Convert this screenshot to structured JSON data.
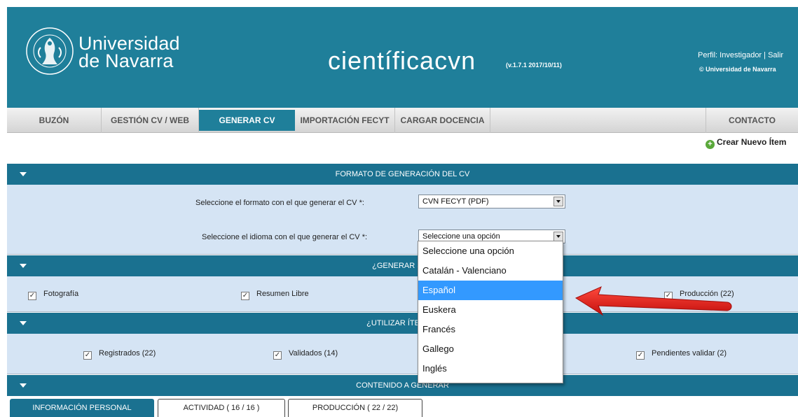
{
  "header": {
    "university_line1": "Universidad",
    "university_line2": "de Navarra",
    "app_title": "científicacvn",
    "version": "(v.1.7.1 2017/10/11)",
    "profile_text": "Perfil: Investigador | Salir",
    "copyright": "© Universidad de Navarra"
  },
  "nav": {
    "items": [
      {
        "label": "BUZÓN"
      },
      {
        "label": "GESTIÓN CV / WEB"
      },
      {
        "label": "GENERAR CV"
      },
      {
        "label": "IMPORTACIÓN FECYT"
      },
      {
        "label": "CARGAR DOCENCIA"
      }
    ],
    "contact": "CONTACTO",
    "active": "GENERAR CV"
  },
  "create_item": "Crear Nuevo Ítem",
  "sections": {
    "format": {
      "title": "FORMATO DE GENERACIÓN DEL CV",
      "format_label": "Seleccione el formato con el que generar el CV *:",
      "format_value": "CVN FECYT (PDF)",
      "language_label": "Seleccione el idioma con el que generar el CV *:",
      "language_value": "Seleccione una opción"
    },
    "generate": {
      "title": "¿GENERAR SEC",
      "items": [
        {
          "label": "Fotografía",
          "checked": true
        },
        {
          "label": "Resumen Libre",
          "checked": true
        },
        {
          "label": "Producción (22)",
          "checked": true
        }
      ]
    },
    "use_items": {
      "title": "¿UTILIZAR ÍTEMS E",
      "items": [
        {
          "label": "Registrados (22)",
          "checked": true
        },
        {
          "label": "Validados (14)",
          "checked": true
        },
        {
          "label": "Pendientes validar (2)",
          "checked": true
        }
      ]
    },
    "content": {
      "title": "CONTENIDO A GENERAR"
    }
  },
  "tabs": [
    {
      "label": "INFORMACIÓN PERSONAL",
      "active": true
    },
    {
      "label": "ACTIVIDAD ( 16 / 16 )",
      "active": false
    },
    {
      "label": "PRODUCCIÓN ( 22 / 22)",
      "active": false
    }
  ],
  "language_dropdown": {
    "options": [
      "Seleccione una opción",
      "Catalán - Valenciano",
      "Español",
      "Euskera",
      "Francés",
      "Gallego",
      "Inglés"
    ],
    "highlighted": "Español"
  },
  "colors": {
    "header_bg": "#1f7f9a",
    "section_bar": "#1a7190",
    "panel_bg": "#d5e4f4",
    "highlight": "#3399ff",
    "arrow": "#e0201d"
  }
}
